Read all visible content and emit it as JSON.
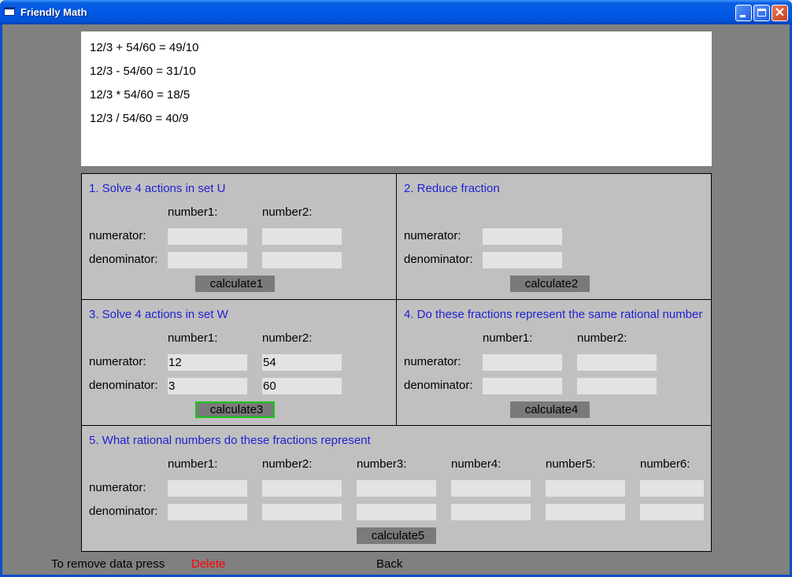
{
  "window": {
    "title": "Friendly Math",
    "close_glyph": "✕"
  },
  "output": {
    "lines": [
      "12/3 + 54/60 = 49/10",
      "12/3 - 54/60 = 31/10",
      "12/3 * 54/60 = 18/5",
      "12/3 / 54/60 = 40/9"
    ]
  },
  "labels": {
    "number1": "number1:",
    "number2": "number2:",
    "number3": "number3:",
    "number4": "number4:",
    "number5": "number5:",
    "number6": "number6:",
    "numerator": "numerator:",
    "denominator": "denominator:"
  },
  "panel1": {
    "title": "1. Solve 4 actions in set U",
    "button": "calculate1",
    "n1_num": "",
    "n2_num": "",
    "n1_den": "",
    "n2_den": ""
  },
  "panel2": {
    "title": "2. Reduce fraction",
    "button": "calculate2",
    "num": "",
    "den": ""
  },
  "panel3": {
    "title": "3. Solve 4 actions in set W",
    "button": "calculate3",
    "n1_num": "12",
    "n2_num": "54",
    "n1_den": "3",
    "n2_den": "60"
  },
  "panel4": {
    "title": "4. Do these fractions represent the same rational number",
    "button": "calculate4",
    "n1_num": "",
    "n2_num": "",
    "n1_den": "",
    "n2_den": ""
  },
  "panel5": {
    "title": "5. What rational numbers do these fractions represent",
    "button": "calculate5",
    "num": [
      "",
      "",
      "",
      "",
      "",
      ""
    ],
    "den": [
      "",
      "",
      "",
      "",
      "",
      ""
    ]
  },
  "footer": {
    "hint": "To remove data press",
    "delete": "Delete",
    "back": "Back"
  },
  "colors": {
    "title_text": "#1f1fd0",
    "delete": "#ff0000",
    "focus_ring": "#19c619",
    "panel_bg": "#c0c0c0"
  }
}
